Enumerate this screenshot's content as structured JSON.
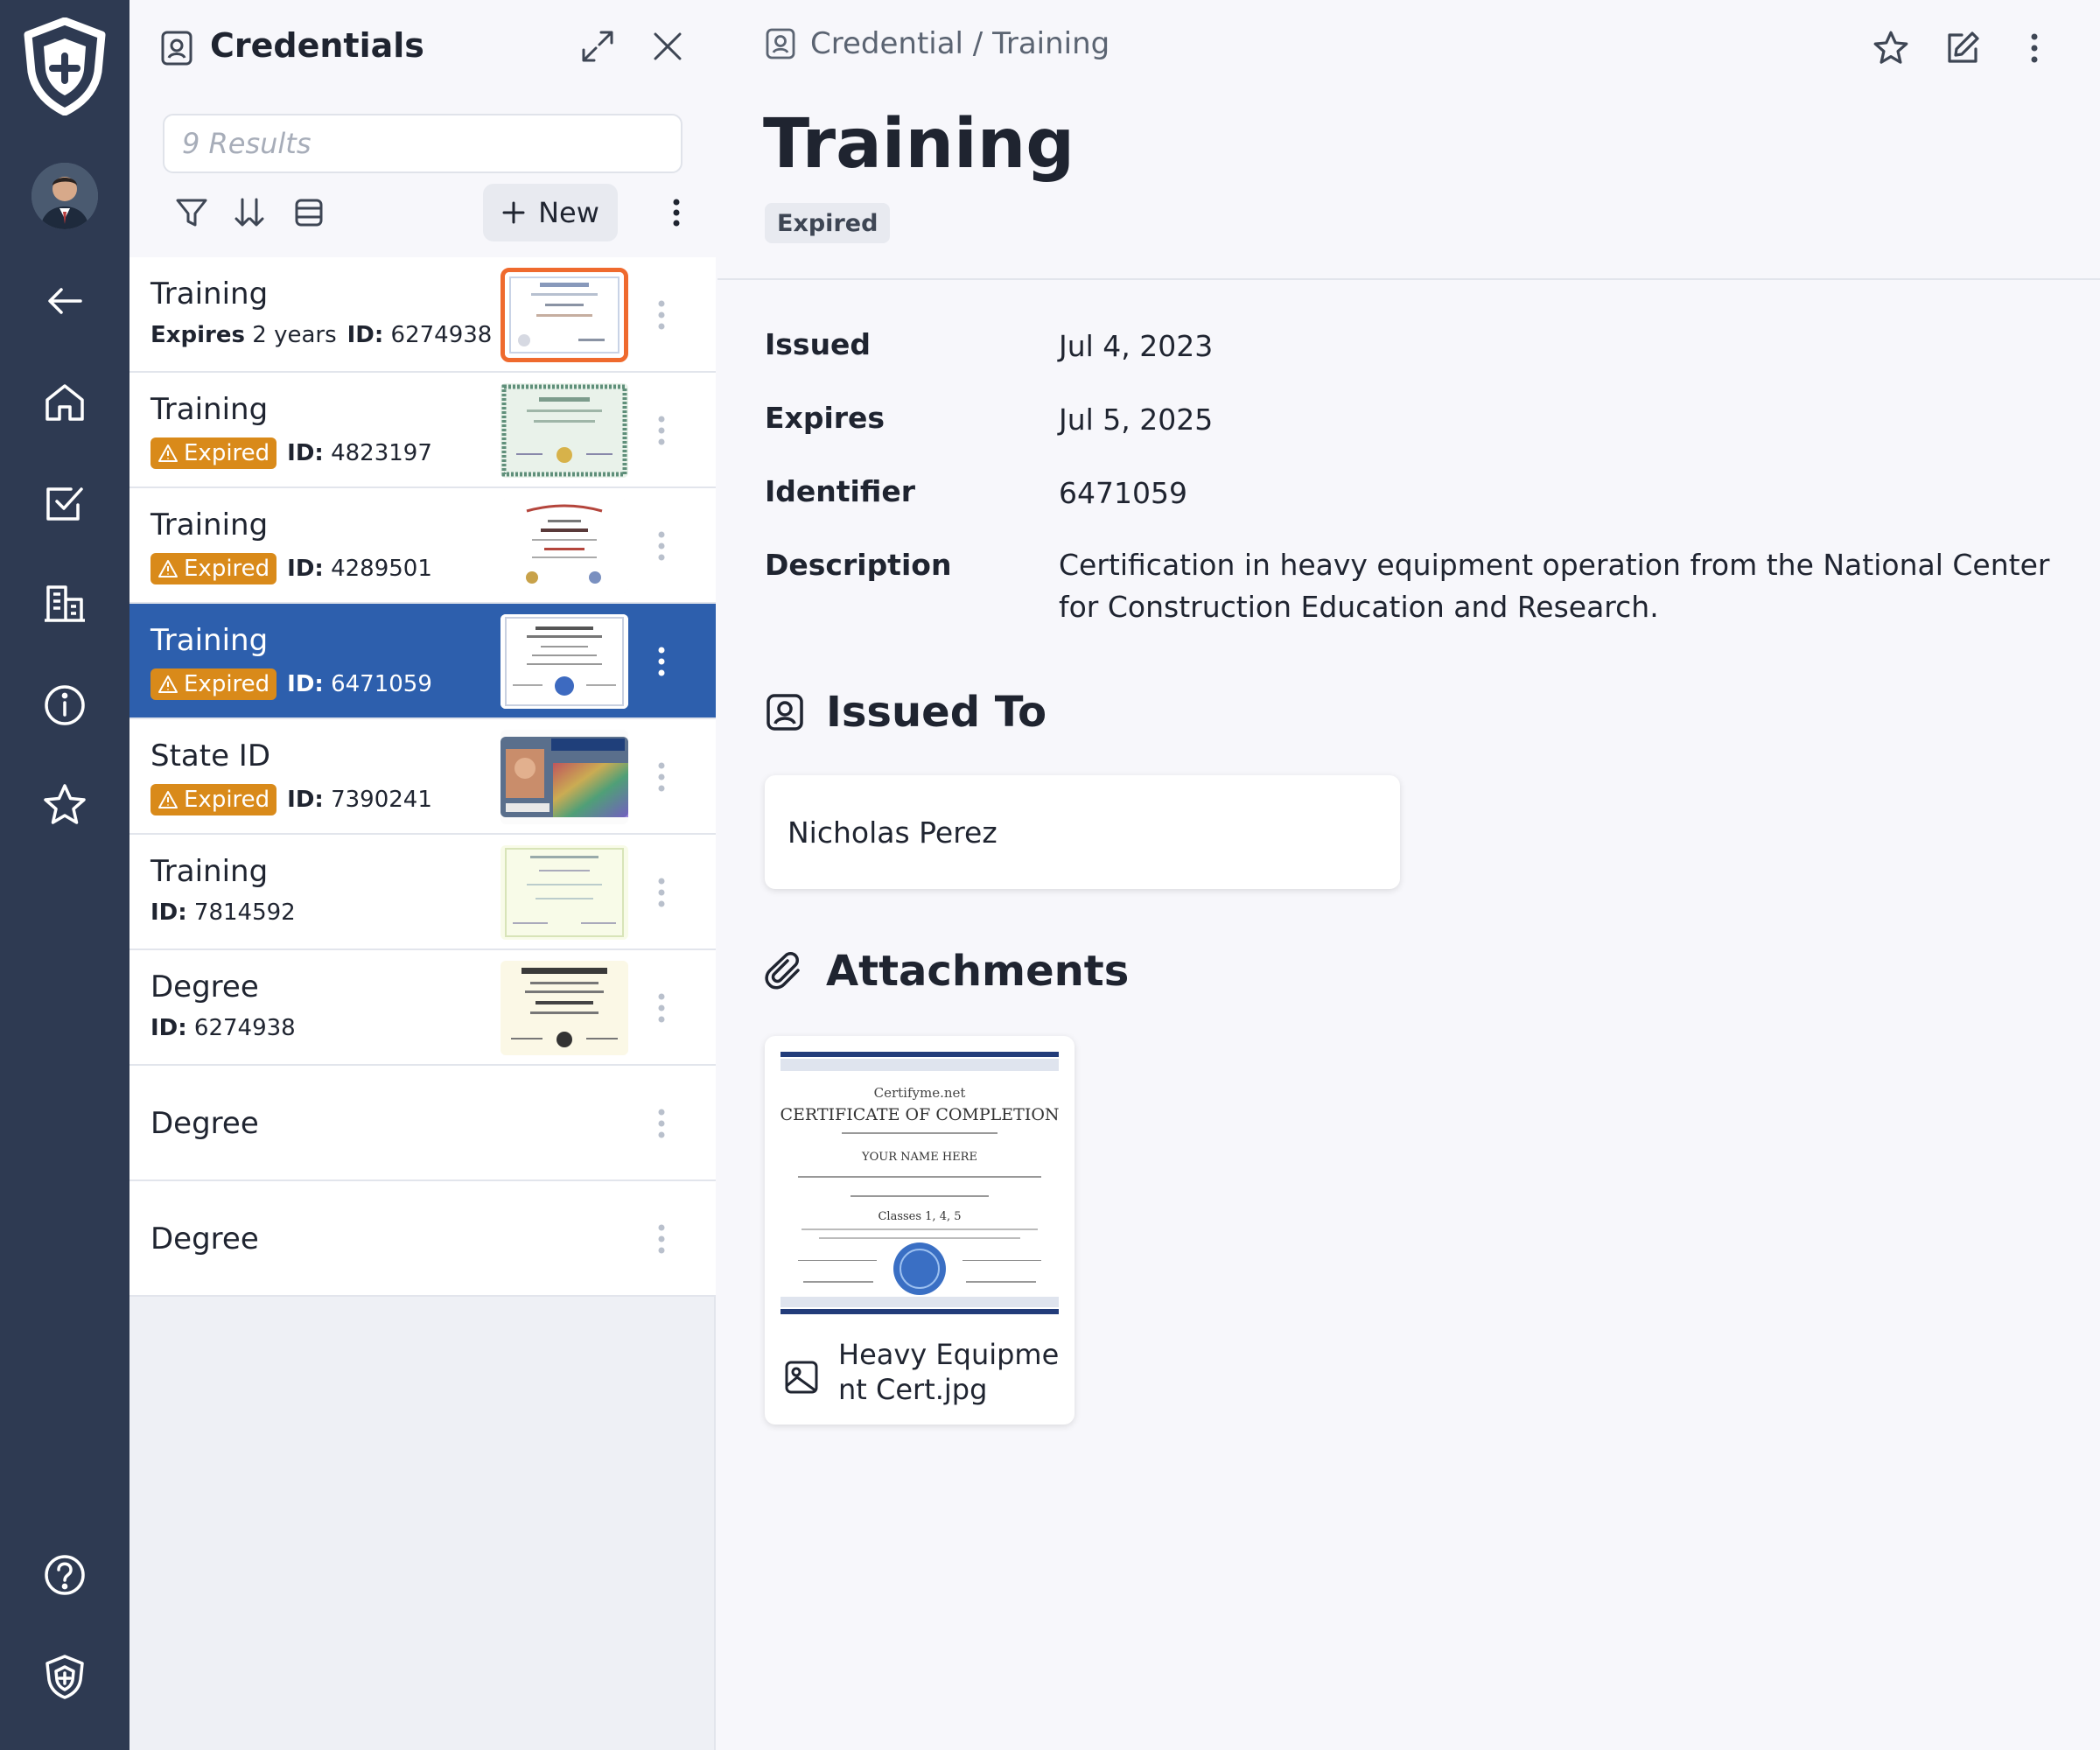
{
  "list_panel": {
    "title": "Credentials",
    "search_placeholder": "9 Results",
    "new_label": "New"
  },
  "items": [
    {
      "title": "Training",
      "expires_label": "Expires",
      "expires_value": "2 years",
      "id_label": "ID:",
      "id": "6274938"
    },
    {
      "title": "Training",
      "status": "Expired",
      "id_label": "ID:",
      "id": "4823197"
    },
    {
      "title": "Training",
      "status": "Expired",
      "id_label": "ID:",
      "id": "4289501"
    },
    {
      "title": "Training",
      "status": "Expired",
      "id_label": "ID:",
      "id": "6471059"
    },
    {
      "title": "State ID",
      "status": "Expired",
      "id_label": "ID:",
      "id": "7390241"
    },
    {
      "title": "Training",
      "id_label": "ID:",
      "id": "7814592"
    },
    {
      "title": "Degree",
      "id_label": "ID:",
      "id": "6274938"
    },
    {
      "title": "Degree"
    },
    {
      "title": "Degree"
    }
  ],
  "detail": {
    "breadcrumb": "Credential / Training",
    "title": "Training",
    "status": "Expired",
    "fields": {
      "issued_label": "Issued",
      "issued": "Jul 4, 2023",
      "expires_label": "Expires",
      "expires": "Jul 5, 2025",
      "identifier_label": "Identifier",
      "identifier": "6471059",
      "description_label": "Description",
      "description": "Certification in heavy equipment operation from the National Center for Construction Education and Research."
    },
    "issued_to_heading": "Issued To",
    "issued_to_name": "Nicholas Perez",
    "attachments_heading": "Attachments",
    "attachment": {
      "filename": "Heavy Equipment Cert.jpg",
      "cert_site": "Certifyme.net",
      "cert_title": "CERTIFICATE OF COMPLETION",
      "cert_name": "YOUR NAME HERE",
      "cert_classes": "Classes 1, 4, 5"
    }
  },
  "colors": {
    "rail": "#2e3a52",
    "selected_row": "#2d5fad",
    "expired_badge": "#d98a1a",
    "highlight_thumb": "#ef6a2e"
  },
  "selected_index": 3
}
